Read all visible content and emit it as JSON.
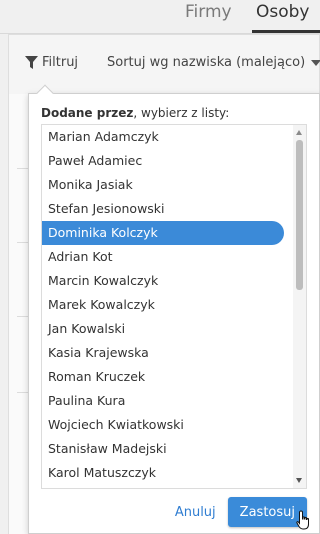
{
  "tabs": {
    "firmy": "Firmy",
    "osoby": "Osoby"
  },
  "toolbar": {
    "filter_label": "Filtruj",
    "sort_label": "Sortuj wg nazwiska (malejąco)"
  },
  "popup": {
    "field_label": "Dodane przez",
    "instruction": ", wybierz z listy:",
    "items": [
      "Marian Adamczyk",
      "Paweł Adamiec",
      "Monika Jasiak",
      "Stefan Jesionowski",
      "Dominika Kolczyk",
      "Adrian Kot",
      "Marcin Kowalczyk",
      "Marek Kowalczyk",
      "Jan Kowalski",
      "Kasia Krajewska",
      "Roman Kruczek",
      "Paulina Kura",
      "Wojciech Kwiatkowski",
      "Stanisław Madejski",
      "Karol Matuszczyk"
    ],
    "selected_index": 4,
    "cancel_label": "Anuluj",
    "apply_label": "Zastosuj"
  },
  "colors": {
    "accent": "#3b8ad8",
    "link": "#2f7dd1"
  }
}
